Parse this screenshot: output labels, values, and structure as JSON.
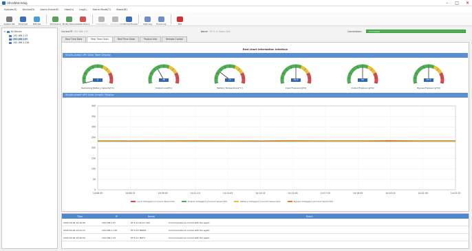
{
  "window": {
    "title": "UltraWatchdog"
  },
  "menu": [
    "System(S)",
    "Device(D)",
    "Alarm Event(E)",
    "View(V)",
    "Log(L)",
    "Alarm Mode(T)",
    "About(B)"
  ],
  "toolbar": [
    {
      "label": "System Set",
      "color": "#7a7a7a",
      "disabled": false
    },
    {
      "label": "Email Set",
      "color": "#3a6fb5",
      "disabled": false
    },
    {
      "label": "SMS Set",
      "color": "#4a9ad8",
      "disabled": false
    },
    {
      "label": "Add Device",
      "color": "#5aa05a",
      "disabled": false
    },
    {
      "label": "Modify Device",
      "color": "#5aa05a",
      "disabled": false
    },
    {
      "label": "Delete Device",
      "color": "#d05050",
      "disabled": false
    },
    {
      "label": "Mute Alarm",
      "color": "#b8b8b8",
      "disabled": true
    },
    {
      "label": "Add Event",
      "color": "#b8b8b8",
      "disabled": true
    },
    {
      "label": "Confirmed Events",
      "color": "#3a6fb5",
      "disabled": false
    },
    {
      "label": "Data Log",
      "color": "#6b8fc0",
      "disabled": false
    },
    {
      "label": "Event Log",
      "color": "#6b8fc0",
      "disabled": false
    },
    {
      "label": "Exit",
      "color": "#d03030",
      "disabled": false
    }
  ],
  "tree": {
    "root": "All Device",
    "items": [
      "192.168.1.23",
      "192.168.1.97",
      "192.168.1.118"
    ],
    "selected_index": 1
  },
  "info": {
    "current_ip_label": "Current IP:",
    "current_ip_value": "192.168.1.97",
    "name_label": "Name:",
    "name_value": "EF-5-11 Room 3A4",
    "comm_label": "Connections:",
    "comm_value": "Connected"
  },
  "tabs": [
    "Real Time Data",
    "Real Time Chart",
    "Real Time State",
    "Product Info",
    "Remote Control"
  ],
  "active_tab": 1,
  "panel_title": "Real chart information interface",
  "section1": "Single-phase UPS Data Table Display",
  "section2": "Single-phase UPS Data Graphic Display",
  "gauges": [
    {
      "label": "Remaining Battery Capacity[%]",
      "value": "0",
      "level": 0
    },
    {
      "label": "Output Load[%]",
      "value": "36",
      "level": 0.36
    },
    {
      "label": "Battery Temperature[°C]",
      "value": "25",
      "level": 0.25
    },
    {
      "label": "Input Frequency[Hz]",
      "value": "49.9",
      "level": 0.5
    },
    {
      "label": "Output Frequency[Hz]",
      "value": "50",
      "level": 0.5
    },
    {
      "label": "Bypass Frequency[Hz]",
      "value": "49.9",
      "level": 0.5
    }
  ],
  "chart_data": {
    "type": "line",
    "x": [
      "14:06:45",
      "14:08:15",
      "14:09:45",
      "14:11:15",
      "14:12:45",
      "14:14:15",
      "14:15:45",
      "14:17:15",
      "14:18:45",
      "14:20:15",
      "14:21:45",
      "14:23:15"
    ],
    "ylim": [
      0,
      400
    ],
    "yticks": [
      0,
      50,
      100,
      150,
      200,
      250,
      300,
      350,
      400
    ],
    "series": [
      {
        "name": "Input Voltage[V] (Current Value:234)",
        "color": "#d84a4a",
        "values": [
          234,
          234,
          234,
          235,
          234,
          234,
          235,
          234,
          234,
          235,
          234,
          234
        ]
      },
      {
        "name": "Output Voltage[V] (Current Value:230)",
        "color": "#4caf50",
        "values": [
          230,
          230,
          230,
          230,
          230,
          230,
          230,
          230,
          230,
          230,
          230,
          230
        ]
      },
      {
        "name": "Battery Voltage[V] (Current Value:219)",
        "color": "#e8c23a",
        "values": [
          232,
          232,
          232,
          232,
          232,
          232,
          232,
          232,
          232,
          232,
          232,
          232
        ]
      },
      {
        "name": "Bypass Voltage[V] (Current Value:234)",
        "color": "#e87a3a",
        "values": [
          234,
          233,
          234,
          234,
          234,
          233,
          234,
          234,
          234,
          233,
          234,
          234
        ]
      }
    ]
  },
  "events": {
    "headers": [
      "Time",
      "IP",
      "Name",
      "Event"
    ],
    "rows": [
      {
        "time": "2020-03-06 14:42:06",
        "ip": "192.168.1.97",
        "name": "EF-5-11 Room 3A4",
        "event": "Communications normal with the agent"
      },
      {
        "time": "2020-03-06 14:41:15",
        "ip": "192.168.1.118",
        "name": "EF-5-15 3B5R4",
        "event": "Communications normal with the agent"
      },
      {
        "time": "2020-03-06 14:40:59",
        "ip": "192.168.1.23",
        "name": "EF-5-11 3E/F4",
        "event": "Communications normal with the agent"
      }
    ]
  }
}
